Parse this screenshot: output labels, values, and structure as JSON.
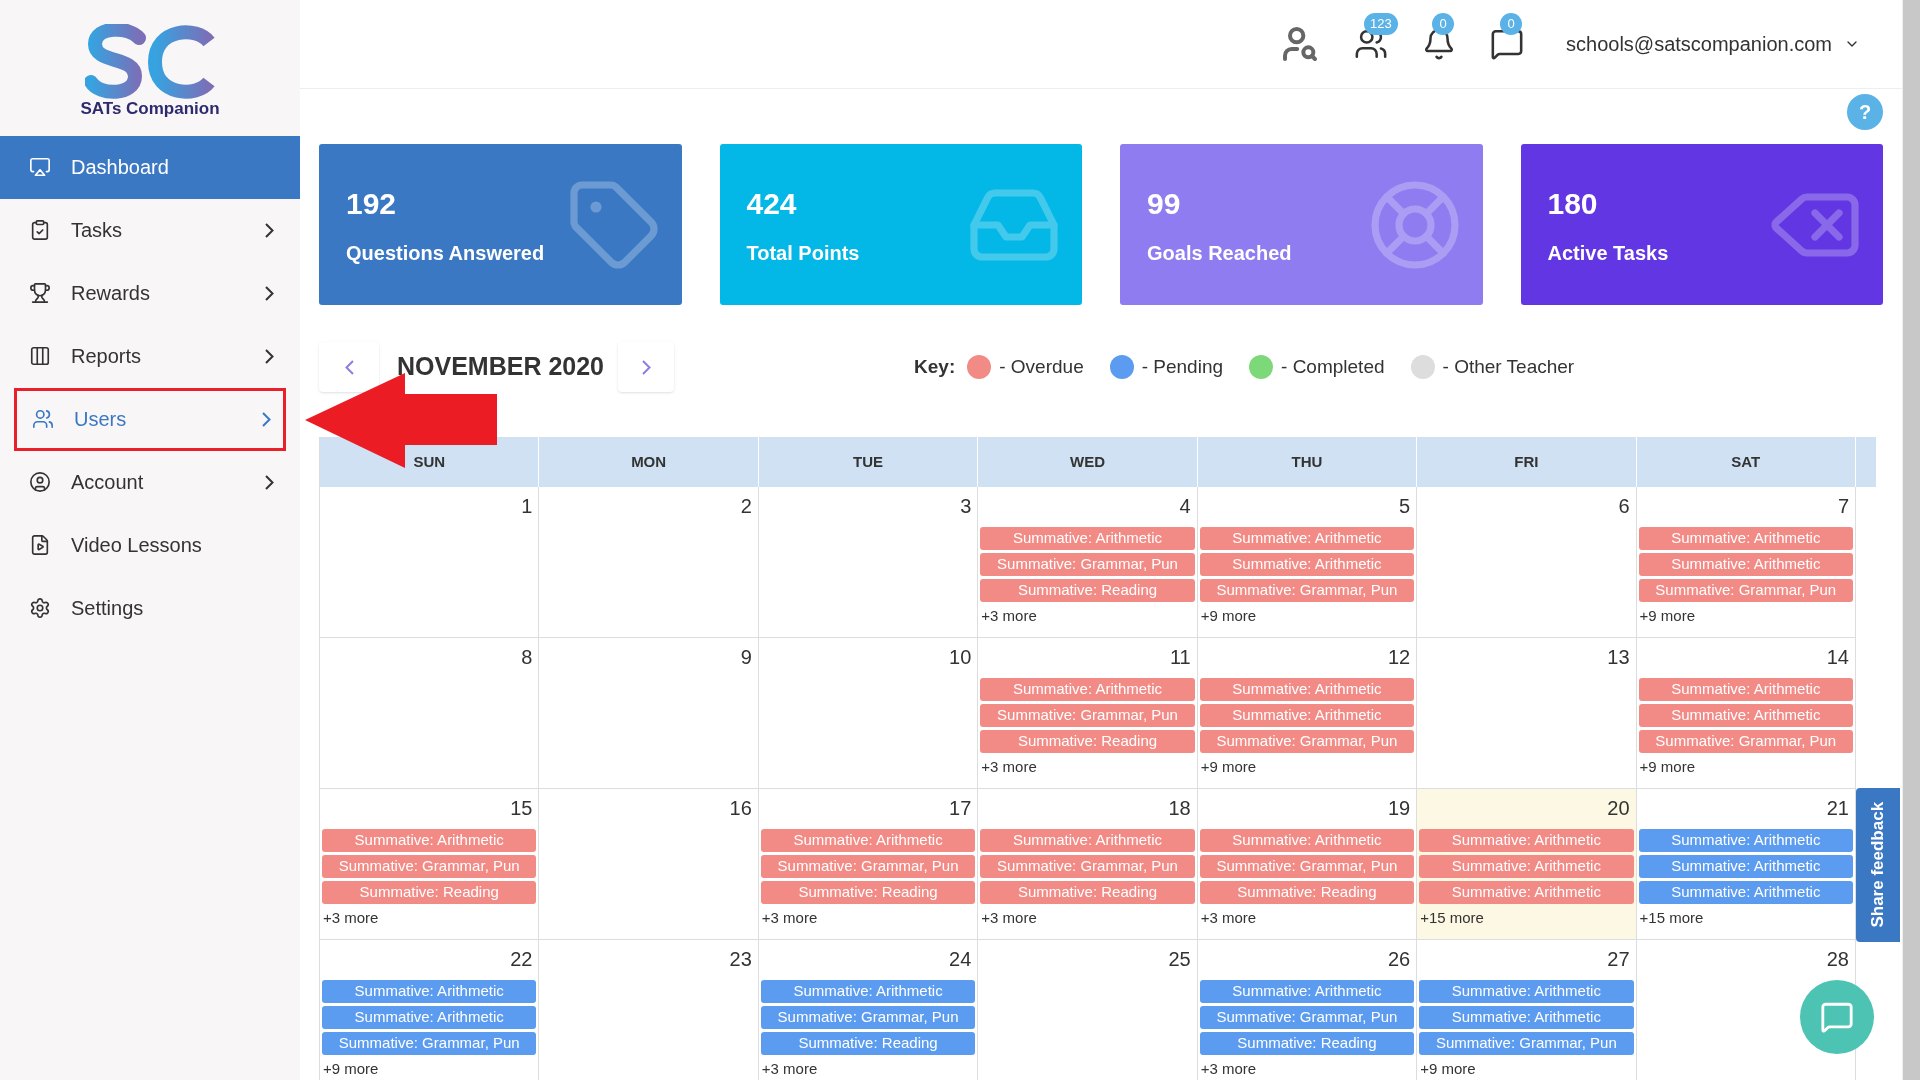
{
  "brand": {
    "name": "SATs Companion"
  },
  "sidebar": {
    "items": [
      {
        "label": "Dashboard",
        "selected": true,
        "expandable": false,
        "highlighted": false
      },
      {
        "label": "Tasks",
        "selected": false,
        "expandable": true,
        "highlighted": false
      },
      {
        "label": "Rewards",
        "selected": false,
        "expandable": true,
        "highlighted": false
      },
      {
        "label": "Reports",
        "selected": false,
        "expandable": true,
        "highlighted": false
      },
      {
        "label": "Users",
        "selected": false,
        "expandable": true,
        "highlighted": true
      },
      {
        "label": "Account",
        "selected": false,
        "expandable": true,
        "highlighted": false
      },
      {
        "label": "Video Lessons",
        "selected": false,
        "expandable": false,
        "highlighted": false
      },
      {
        "label": "Settings",
        "selected": false,
        "expandable": false,
        "highlighted": false
      }
    ]
  },
  "header": {
    "badges": [
      "123",
      "0",
      "0"
    ],
    "account": "schools@satscompanion.com",
    "help": "?"
  },
  "stats": [
    {
      "value": "192",
      "label": "Questions Answered",
      "color": "#3b78c3"
    },
    {
      "value": "424",
      "label": "Total Points",
      "color": "#03b7e6"
    },
    {
      "value": "99",
      "label": "Goals Reached",
      "color": "#8f7cf0"
    },
    {
      "value": "180",
      "label": "Active Tasks",
      "color": "#6236e3"
    }
  ],
  "calendar": {
    "month": "NOVEMBER 2020",
    "key_label": "Key:",
    "legend": [
      {
        "label": "- Overdue",
        "color": "#f28b86"
      },
      {
        "label": "- Pending",
        "color": "#5c9cf0"
      },
      {
        "label": "- Completed",
        "color": "#7dd87a"
      },
      {
        "label": "- Other Teacher",
        "color": "#dddddd"
      }
    ],
    "weekdays": [
      "SUN",
      "MON",
      "TUE",
      "WED",
      "THU",
      "FRI",
      "SAT"
    ],
    "weeks": [
      [
        {
          "day": "1",
          "today": false
        },
        {
          "day": "2",
          "today": false
        },
        {
          "day": "3",
          "today": false
        },
        {
          "day": "4",
          "today": false,
          "events": [
            {
              "label": "Summative: Arithmetic",
              "kind": "overdue"
            },
            {
              "label": "Summative: Grammar, Pun",
              "kind": "overdue"
            },
            {
              "label": "Summative: Reading",
              "kind": "overdue"
            }
          ],
          "more": "+3 more"
        },
        {
          "day": "5",
          "today": false,
          "events": [
            {
              "label": "Summative: Arithmetic",
              "kind": "overdue"
            },
            {
              "label": "Summative: Arithmetic",
              "kind": "overdue"
            },
            {
              "label": "Summative: Grammar, Pun",
              "kind": "overdue"
            }
          ],
          "more": "+9 more"
        },
        {
          "day": "6",
          "today": false
        },
        {
          "day": "7",
          "today": false,
          "events": [
            {
              "label": "Summative: Arithmetic",
              "kind": "overdue"
            },
            {
              "label": "Summative: Arithmetic",
              "kind": "overdue"
            },
            {
              "label": "Summative: Grammar, Pun",
              "kind": "overdue"
            }
          ],
          "more": "+9 more"
        }
      ],
      [
        {
          "day": "8",
          "today": false
        },
        {
          "day": "9",
          "today": false
        },
        {
          "day": "10",
          "today": false
        },
        {
          "day": "11",
          "today": false,
          "events": [
            {
              "label": "Summative: Arithmetic",
              "kind": "overdue"
            },
            {
              "label": "Summative: Grammar, Pun",
              "kind": "overdue"
            },
            {
              "label": "Summative: Reading",
              "kind": "overdue"
            }
          ],
          "more": "+3 more"
        },
        {
          "day": "12",
          "today": false,
          "events": [
            {
              "label": "Summative: Arithmetic",
              "kind": "overdue"
            },
            {
              "label": "Summative: Arithmetic",
              "kind": "overdue"
            },
            {
              "label": "Summative: Grammar, Pun",
              "kind": "overdue"
            }
          ],
          "more": "+9 more"
        },
        {
          "day": "13",
          "today": false
        },
        {
          "day": "14",
          "today": false,
          "events": [
            {
              "label": "Summative: Arithmetic",
              "kind": "overdue"
            },
            {
              "label": "Summative: Arithmetic",
              "kind": "overdue"
            },
            {
              "label": "Summative: Grammar, Pun",
              "kind": "overdue"
            }
          ],
          "more": "+9 more"
        }
      ],
      [
        {
          "day": "15",
          "today": false,
          "events": [
            {
              "label": "Summative: Arithmetic",
              "kind": "overdue"
            },
            {
              "label": "Summative: Grammar, Pun",
              "kind": "overdue"
            },
            {
              "label": "Summative: Reading",
              "kind": "overdue"
            }
          ],
          "more": "+3 more"
        },
        {
          "day": "16",
          "today": false
        },
        {
          "day": "17",
          "today": false,
          "events": [
            {
              "label": "Summative: Arithmetic",
              "kind": "overdue"
            },
            {
              "label": "Summative: Grammar, Pun",
              "kind": "overdue"
            },
            {
              "label": "Summative: Reading",
              "kind": "overdue"
            }
          ],
          "more": "+3 more"
        },
        {
          "day": "18",
          "today": false,
          "events": [
            {
              "label": "Summative: Arithmetic",
              "kind": "overdue"
            },
            {
              "label": "Summative: Grammar, Pun",
              "kind": "overdue"
            },
            {
              "label": "Summative: Reading",
              "kind": "overdue"
            }
          ],
          "more": "+3 more"
        },
        {
          "day": "19",
          "today": false,
          "events": [
            {
              "label": "Summative: Arithmetic",
              "kind": "overdue"
            },
            {
              "label": "Summative: Grammar, Pun",
              "kind": "overdue"
            },
            {
              "label": "Summative: Reading",
              "kind": "overdue"
            }
          ],
          "more": "+3 more"
        },
        {
          "day": "20",
          "today": true,
          "events": [
            {
              "label": "Summative: Arithmetic",
              "kind": "overdue"
            },
            {
              "label": "Summative: Arithmetic",
              "kind": "overdue"
            },
            {
              "label": "Summative: Arithmetic",
              "kind": "overdue"
            }
          ],
          "more": "+15 more"
        },
        {
          "day": "21",
          "today": false,
          "events": [
            {
              "label": "Summative: Arithmetic",
              "kind": "pending"
            },
            {
              "label": "Summative: Arithmetic",
              "kind": "pending"
            },
            {
              "label": "Summative: Arithmetic",
              "kind": "pending"
            }
          ],
          "more": "+15 more"
        }
      ],
      [
        {
          "day": "22",
          "today": false,
          "events": [
            {
              "label": "Summative: Arithmetic",
              "kind": "pending"
            },
            {
              "label": "Summative: Arithmetic",
              "kind": "pending"
            },
            {
              "label": "Summative: Grammar, Pun",
              "kind": "pending"
            }
          ],
          "more": "+9 more"
        },
        {
          "day": "23",
          "today": false
        },
        {
          "day": "24",
          "today": false,
          "events": [
            {
              "label": "Summative: Arithmetic",
              "kind": "pending"
            },
            {
              "label": "Summative: Grammar, Pun",
              "kind": "pending"
            },
            {
              "label": "Summative: Reading",
              "kind": "pending"
            }
          ],
          "more": "+3 more"
        },
        {
          "day": "25",
          "today": false
        },
        {
          "day": "26",
          "today": false,
          "events": [
            {
              "label": "Summative: Arithmetic",
              "kind": "pending"
            },
            {
              "label": "Summative: Grammar, Pun",
              "kind": "pending"
            },
            {
              "label": "Summative: Reading",
              "kind": "pending"
            }
          ],
          "more": "+3 more"
        },
        {
          "day": "27",
          "today": false,
          "events": [
            {
              "label": "Summative: Arithmetic",
              "kind": "pending"
            },
            {
              "label": "Summative: Arithmetic",
              "kind": "pending"
            },
            {
              "label": "Summative: Grammar, Pun",
              "kind": "pending"
            }
          ],
          "more": "+9 more"
        },
        {
          "day": "28",
          "today": false
        }
      ]
    ]
  },
  "feedback_tab": "Share feedback"
}
